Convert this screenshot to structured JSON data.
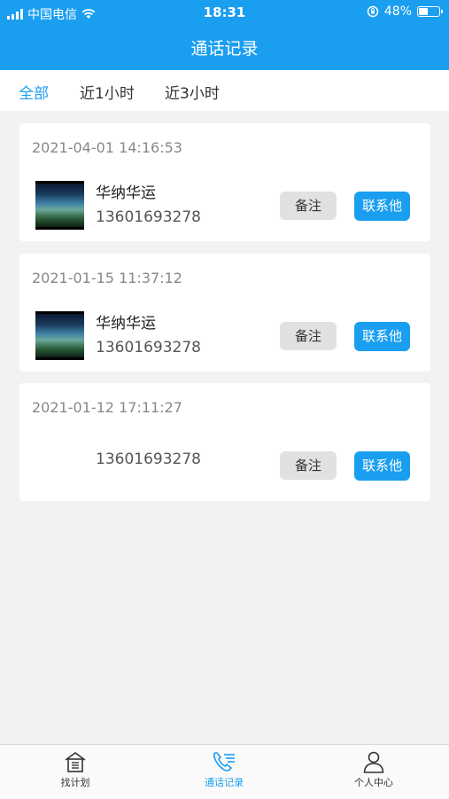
{
  "status_bar": {
    "carrier": "中国电信",
    "time": "18:31",
    "battery": "48%",
    "battery_level": 0.48
  },
  "header": {
    "title": "通话记录"
  },
  "tabs": [
    {
      "label": "全部",
      "active": true
    },
    {
      "label": "近1小时",
      "active": false
    },
    {
      "label": "近3小时",
      "active": false
    }
  ],
  "records": [
    {
      "datetime": "2021-04-01 14:16:53",
      "name": "华纳华运",
      "phone": "13601693278",
      "note_label": "备注",
      "contact_label": "联系他"
    },
    {
      "datetime": "2021-01-15 11:37:12",
      "name": "华纳华运",
      "phone": "13601693278",
      "note_label": "备注",
      "contact_label": "联系他"
    },
    {
      "datetime": "2021-01-12 17:11:27",
      "name": "",
      "phone": "13601693278",
      "note_label": "备注",
      "contact_label": "联系他"
    }
  ],
  "bottom_nav": [
    {
      "label": "找计划",
      "icon": "building-icon",
      "active": false
    },
    {
      "label": "通话记录",
      "icon": "phone-list-icon",
      "active": true
    },
    {
      "label": "个人中心",
      "icon": "person-icon",
      "active": false
    }
  ],
  "colors": {
    "accent": "#1a9ef0",
    "background": "#f2f2f2"
  }
}
